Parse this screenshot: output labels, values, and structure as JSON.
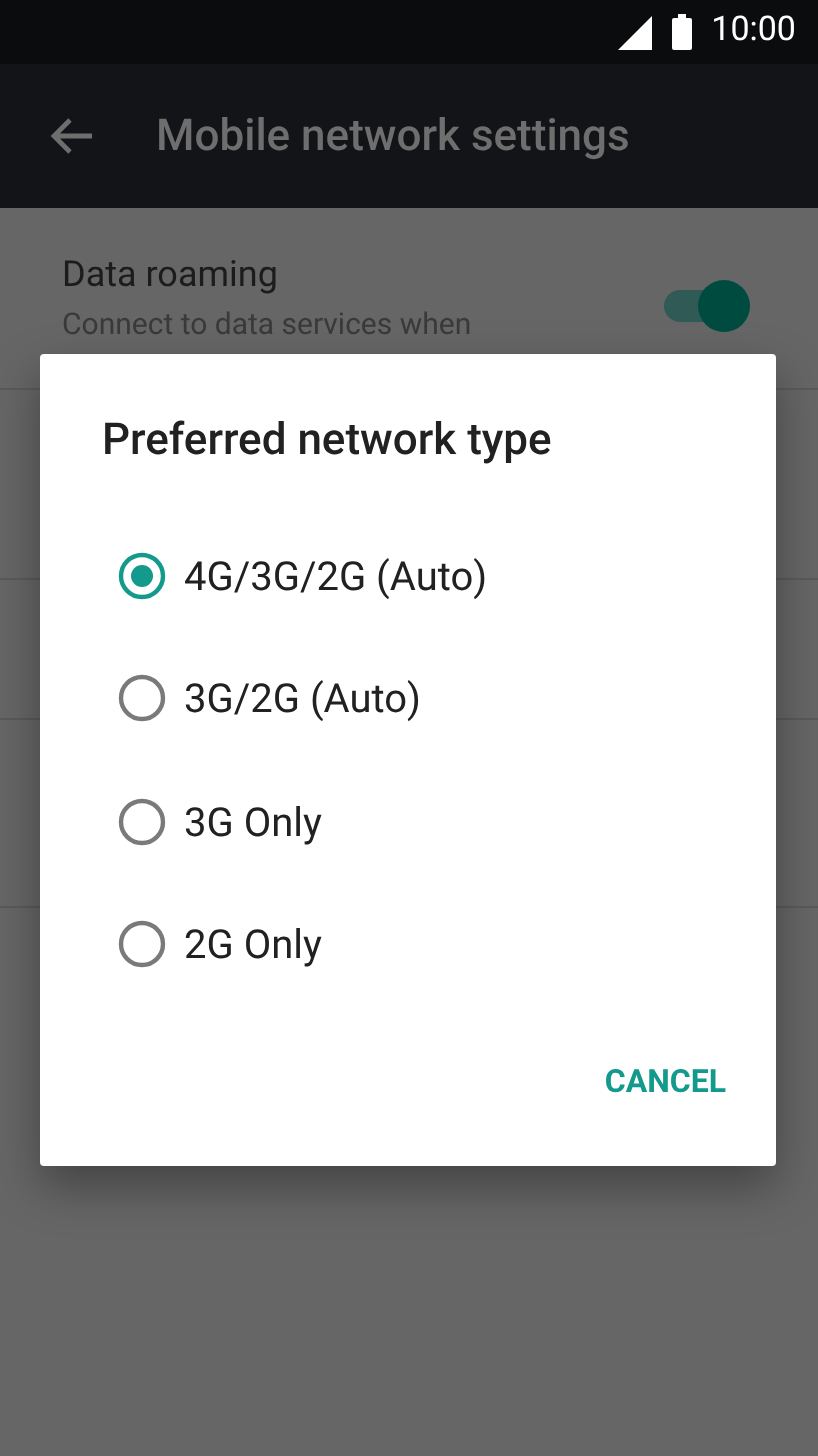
{
  "status_bar": {
    "time": "10:00"
  },
  "app_bar": {
    "title": "Mobile network settings"
  },
  "settings": [
    {
      "title": "Data roaming",
      "subtitle": "Connect to data services when",
      "on": true
    }
  ],
  "dialog": {
    "title": "Preferred network type",
    "options": [
      {
        "label": "4G/3G/2G (Auto)",
        "selected": true
      },
      {
        "label": "3G/2G (Auto)",
        "selected": false
      },
      {
        "label": "3G Only",
        "selected": false
      },
      {
        "label": "2G Only",
        "selected": false
      }
    ],
    "buttons": [
      "CANCEL"
    ]
  }
}
